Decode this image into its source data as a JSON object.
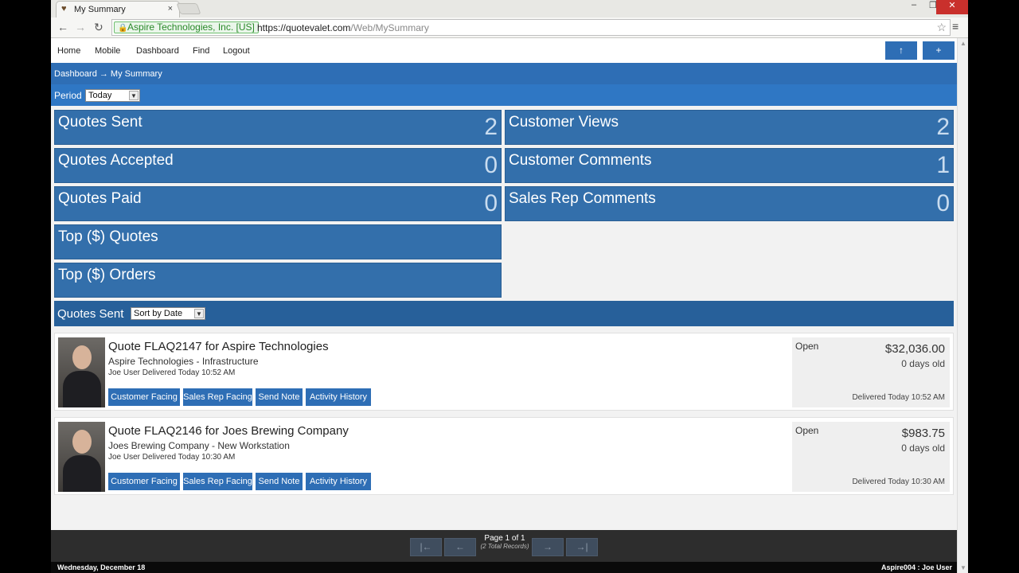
{
  "browser": {
    "tab_title": "My Summary",
    "close_tab_glyph": "×",
    "cert_name": "Aspire Technologies, Inc. [US]",
    "url_host": "https://quotevalet.com",
    "url_path": "/Web/MySummary"
  },
  "topnav": {
    "links": [
      "Home",
      "Mobile",
      "Dashboard",
      "Find",
      "Logout"
    ],
    "up_button": "↑",
    "add_button": "+"
  },
  "breadcrumb": "Dashboard → My Summary",
  "period": {
    "label": "Period",
    "selected": "Today"
  },
  "tiles": {
    "quotes_sent": {
      "label": "Quotes Sent",
      "count": "2"
    },
    "customer_views": {
      "label": "Customer Views",
      "count": "2"
    },
    "quotes_accepted": {
      "label": "Quotes Accepted",
      "count": "0"
    },
    "customer_comments": {
      "label": "Customer Comments",
      "count": "1"
    },
    "quotes_paid": {
      "label": "Quotes Paid",
      "count": "0"
    },
    "sales_rep_comments": {
      "label": "Sales Rep Comments",
      "count": "0"
    },
    "top_quotes": {
      "label": "Top ($) Quotes"
    },
    "top_orders": {
      "label": "Top ($) Orders"
    }
  },
  "list": {
    "title": "Quotes Sent",
    "sort": "Sort by Date"
  },
  "quote_buttons": [
    "Customer Facing",
    "Sales Rep Facing",
    "Send Note",
    "Activity History"
  ],
  "quotes": [
    {
      "title": "Quote FLAQ2147 for Aspire Technologies",
      "subtitle": "Aspire Technologies - Infrastructure",
      "delivered_by": "Joe User Delivered Today 10:52 AM",
      "status": "Open",
      "amount": "$32,036.00",
      "age": "0 days old",
      "delivered": "Delivered Today 10:52 AM"
    },
    {
      "title": "Quote FLAQ2146 for Joes Brewing Company",
      "subtitle": "Joes Brewing Company - New Workstation",
      "delivered_by": "Joe User Delivered Today 10:30 AM",
      "status": "Open",
      "amount": "$983.75",
      "age": "0 days old",
      "delivered": "Delivered Today 10:30 AM"
    }
  ],
  "pager": {
    "first": "|←",
    "prev": "←",
    "next": "→",
    "last": "→|",
    "page_text": "Page 1 of 1",
    "records_text": "(2 Total Records)"
  },
  "footer": {
    "date": "Wednesday, December 18",
    "user": "Aspire004 : Joe User"
  },
  "colors": {
    "primary": "#2e6eb5",
    "tile": "#336fab",
    "header": "#27609a",
    "footer": "#0a0a0a"
  }
}
